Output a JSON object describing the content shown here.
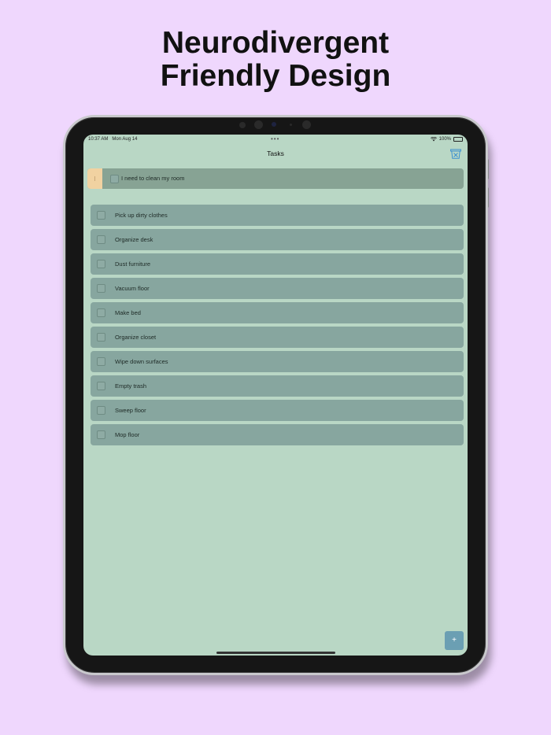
{
  "headline": {
    "line1": "Neurodivergent",
    "line2": "Friendly Design"
  },
  "status_bar": {
    "time": "10:37 AM",
    "date": "Mon Aug 14",
    "battery": "100%"
  },
  "screen_title": "Tasks",
  "parent_task": {
    "label": "I need to clean my room",
    "checked": false
  },
  "subtasks": [
    {
      "label": "Pick up dirty clothes",
      "checked": false
    },
    {
      "label": "Organize desk",
      "checked": false
    },
    {
      "label": "Dust furniture",
      "checked": false
    },
    {
      "label": "Vacuum floor",
      "checked": false
    },
    {
      "label": "Make bed",
      "checked": false
    },
    {
      "label": "Organize closet",
      "checked": false
    },
    {
      "label": "Wipe down surfaces",
      "checked": false
    },
    {
      "label": "Empty trash",
      "checked": false
    },
    {
      "label": "Sweep floor",
      "checked": false
    },
    {
      "label": "Mop floor",
      "checked": false
    }
  ],
  "add_button": {
    "label": "+"
  },
  "icons": {
    "trash": "trash-icon",
    "wifi": "wifi-icon",
    "battery": "battery-icon",
    "drag": "drag-handle-icon"
  },
  "colors": {
    "background": "#efd7fd",
    "screen": "#b9d7c5",
    "row": "#87a69f",
    "parent_row": "#87a394",
    "drag_handle": "#f1d2a1",
    "add_button": "#6b9fb3",
    "trash_icon": "#3a8fd0"
  }
}
